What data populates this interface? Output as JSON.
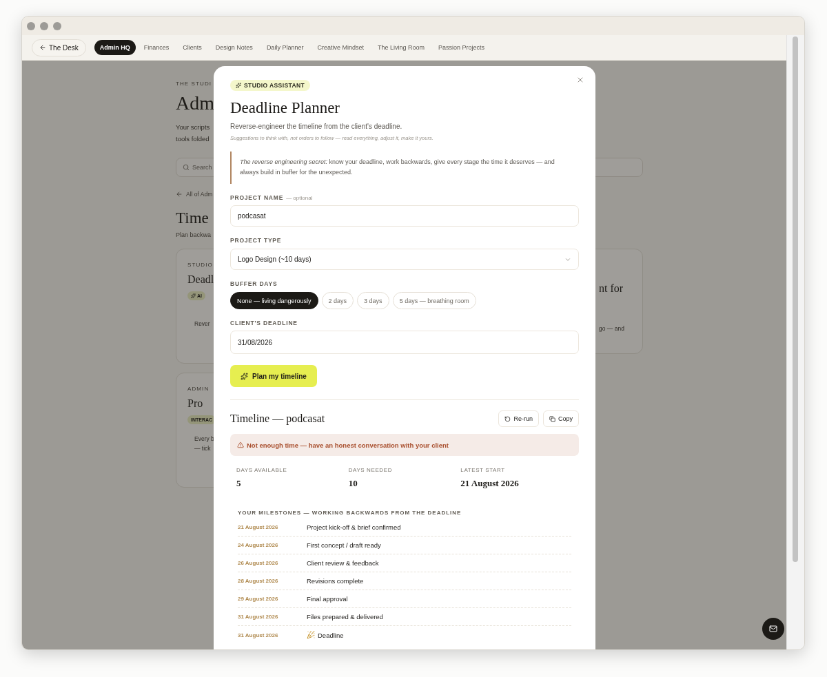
{
  "nav": {
    "back": "The Desk",
    "tabs": [
      {
        "label": "Admin HQ",
        "selected": true
      },
      {
        "label": "Finances",
        "selected": false
      },
      {
        "label": "Clients",
        "selected": false
      },
      {
        "label": "Design Notes",
        "selected": false
      },
      {
        "label": "Daily Planner",
        "selected": false
      },
      {
        "label": "Creative Mindset",
        "selected": false
      },
      {
        "label": "The Living Room",
        "selected": false
      },
      {
        "label": "Passion Projects",
        "selected": false
      }
    ]
  },
  "background_page": {
    "eyebrow": "THE STUDI",
    "title": "Adm",
    "intro": [
      "Your scripts",
      "tools folded"
    ],
    "search": {
      "placeholder": "Search"
    },
    "back_link": "All of Adm",
    "section_title": "Time",
    "section_subtitle": "Plan backwa",
    "cards": [
      {
        "kind": "assistant",
        "eyebrow": "STUDIO",
        "title": "Deadl",
        "tag": "AI",
        "lines": [
          "Rever"
        ]
      },
      {
        "title": "nt for",
        "lines": [
          "go — and"
        ]
      },
      {
        "kind": "interactive",
        "eyebrow": "ADMIN",
        "title": "Pro",
        "tag": "INTERAC",
        "lines": [
          "Every b",
          "— tick"
        ]
      }
    ]
  },
  "modal": {
    "badge": "STUDIO ASSISTANT",
    "title": "Deadline Planner",
    "subtitle": "Reverse-engineer the timeline from the client's deadline.",
    "note": "Suggestions to think with, not orders to follow — read everything, adjust it, make it yours.",
    "tip": "*The reverse engineering secret:* know your deadline, work backwards, give every stage the time it deserves — and always build in buffer for the unexpected.",
    "project_name": {
      "label": "PROJECT NAME",
      "hint": "— optional",
      "value": "podcasat"
    },
    "project_type": {
      "label": "PROJECT TYPE",
      "value": "Logo Design (~10 days)"
    },
    "buffer_days": {
      "label": "BUFFER DAYS",
      "options": [
        {
          "label": "None — living dangerously",
          "selected": true
        },
        {
          "label": "2 days",
          "selected": false
        },
        {
          "label": "3 days",
          "selected": false
        },
        {
          "label": "5 days — breathing room",
          "selected": false
        }
      ]
    },
    "deadline": {
      "label": "CLIENT'S DEADLINE",
      "value": "31/08/2026"
    },
    "submit": "Plan my timeline",
    "result": {
      "title": "Timeline — podcasat",
      "actions": [
        "Re-run",
        "Copy"
      ],
      "alert": "Not enough time — have an honest conversation with your client",
      "stats": [
        {
          "label": "DAYS AVAILABLE",
          "value": "5"
        },
        {
          "label": "DAYS NEEDED",
          "value": "10"
        },
        {
          "label": "LATEST START",
          "value": "21 August 2026"
        }
      ],
      "milestones_heading": "YOUR MILESTONES — WORKING BACKWARDS FROM THE DEADLINE",
      "milestones": [
        {
          "date": "21 August 2026",
          "task": "Project kick-off & brief confirmed",
          "kind": "step"
        },
        {
          "date": "24 August 2026",
          "task": "First concept / draft ready",
          "kind": "step"
        },
        {
          "date": "26 August 2026",
          "task": "Client review & feedback",
          "kind": "step"
        },
        {
          "date": "28 August 2026",
          "task": "Revisions complete",
          "kind": "step"
        },
        {
          "date": "29 August 2026",
          "task": "Final approval",
          "kind": "step"
        },
        {
          "date": "31 August 2026",
          "task": "Files prepared & delivered",
          "kind": "step"
        },
        {
          "date": "31 August 2026",
          "task": "Deadline",
          "kind": "deadline"
        }
      ]
    }
  }
}
